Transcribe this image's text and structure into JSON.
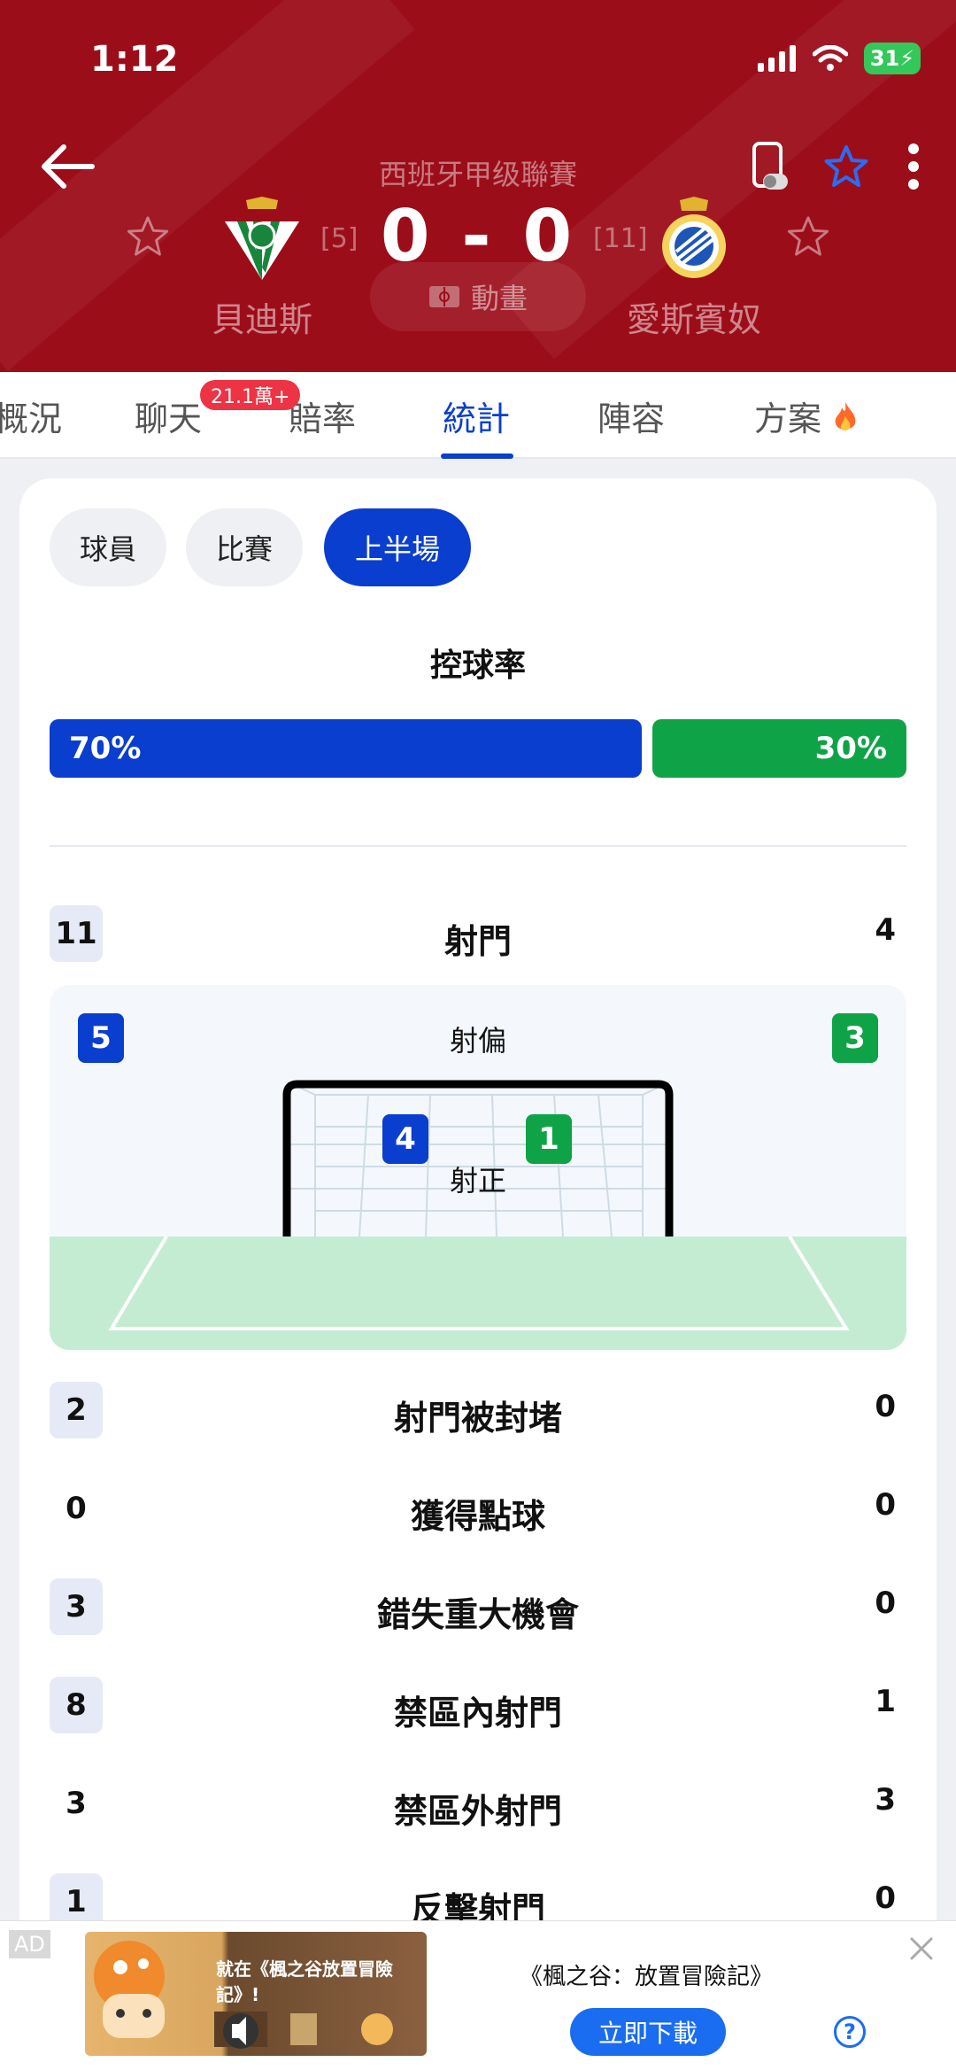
{
  "status": {
    "time": "1:12",
    "battery": "31"
  },
  "header": {
    "league": "西班牙甲级聯賽",
    "score": "0 - 0",
    "home": {
      "name": "貝迪斯",
      "rank": "[5]"
    },
    "away": {
      "name": "愛斯賓奴",
      "rank": "[11]"
    },
    "animation_label": "動畫"
  },
  "tabs": [
    {
      "label": "概況"
    },
    {
      "label": "聊天",
      "badge": "21.1萬+"
    },
    {
      "label": "賠率"
    },
    {
      "label": "統計"
    },
    {
      "label": "陣容"
    },
    {
      "label": "方案"
    }
  ],
  "active_tab": "統計",
  "filters": [
    "球員",
    "比賽",
    "上半場"
  ],
  "active_filter": "上半場",
  "possession": {
    "title": "控球率",
    "home": "70%",
    "away": "30%",
    "home_fraction": 0.7
  },
  "shots": {
    "label": "射門",
    "home": "11",
    "away": "4"
  },
  "goal_panel": {
    "off_target_label": "射偏",
    "off_home": "5",
    "off_away": "3",
    "on_target_label": "射正",
    "on_home": "4",
    "on_away": "1"
  },
  "stats": [
    {
      "label": "射門被封堵",
      "home": "2",
      "away": "0",
      "home_highlight": true
    },
    {
      "label": "獲得點球",
      "home": "0",
      "away": "0",
      "home_highlight": false
    },
    {
      "label": "錯失重大機會",
      "home": "3",
      "away": "0",
      "home_highlight": true
    },
    {
      "label": "禁區內射門",
      "home": "8",
      "away": "1",
      "home_highlight": true
    },
    {
      "label": "禁區外射門",
      "home": "3",
      "away": "3",
      "home_highlight": false
    },
    {
      "label": "反擊射門",
      "home": "1",
      "away": "0",
      "home_highlight": true
    }
  ],
  "ad": {
    "tag": "AD",
    "image_text": "就在《楓之谷放置冒險記》!",
    "title": "《楓之谷：放置冒險記》",
    "button": "立即下載",
    "help": "?"
  },
  "colors": {
    "home": "#0a3ecf",
    "away": "#0fa347",
    "header": "#9c0d1a"
  }
}
